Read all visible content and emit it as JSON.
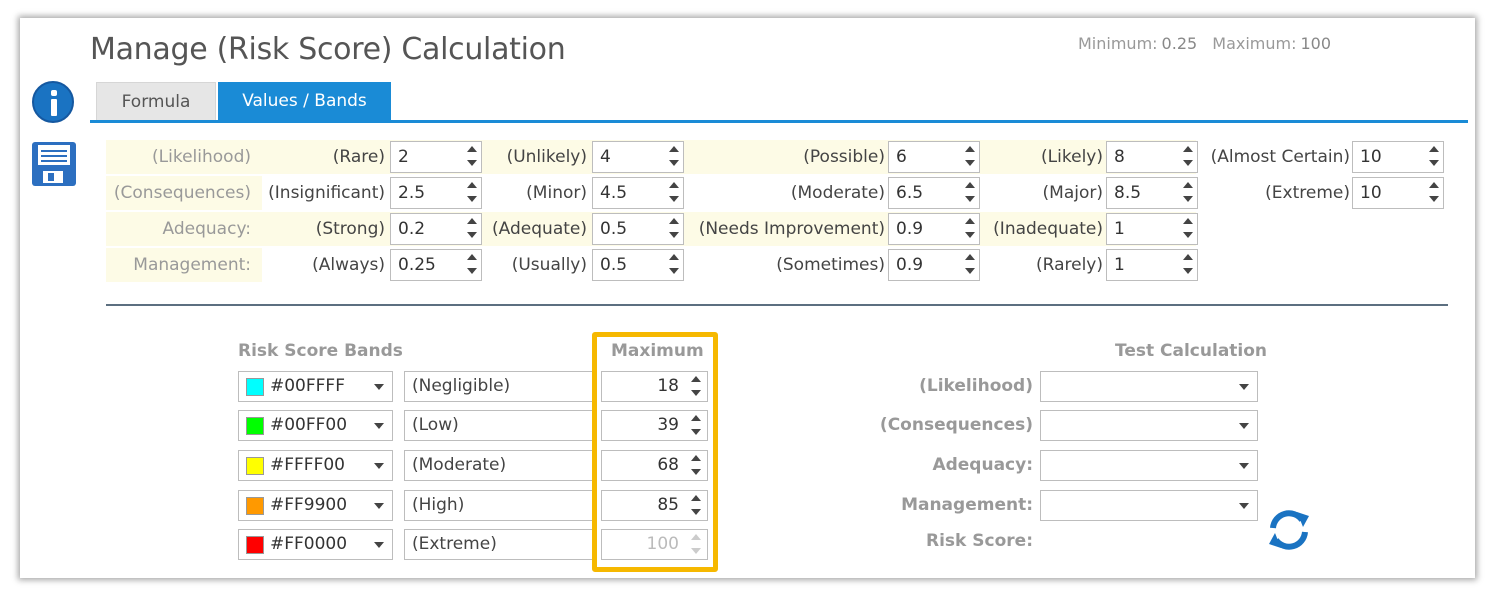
{
  "header": {
    "title": "Manage (Risk Score) Calculation",
    "minimum_label": "Minimum:",
    "minimum_value": "0.25",
    "maximum_label": "Maximum:",
    "maximum_value": "100"
  },
  "tabs": [
    {
      "label": "Formula",
      "active": false
    },
    {
      "label": "Values / Bands",
      "active": true
    }
  ],
  "factors": [
    {
      "label": "(Likelihood)",
      "items": [
        {
          "label": "(Rare)",
          "value": "2"
        },
        {
          "label": "(Unlikely)",
          "value": "4"
        },
        {
          "label": "(Possible)",
          "value": "6"
        },
        {
          "label": "(Likely)",
          "value": "8"
        },
        {
          "label": "(Almost Certain)",
          "value": "10"
        }
      ]
    },
    {
      "label": "(Consequences)",
      "items": [
        {
          "label": "(Insignificant)",
          "value": "2.5"
        },
        {
          "label": "(Minor)",
          "value": "4.5"
        },
        {
          "label": "(Moderate)",
          "value": "6.5"
        },
        {
          "label": "(Major)",
          "value": "8.5"
        },
        {
          "label": "(Extreme)",
          "value": "10"
        }
      ]
    },
    {
      "label": "Adequacy:",
      "items": [
        {
          "label": "(Strong)",
          "value": "0.2"
        },
        {
          "label": "(Adequate)",
          "value": "0.5"
        },
        {
          "label": "(Needs Improvement)",
          "value": "0.9"
        },
        {
          "label": "(Inadequate)",
          "value": "1"
        }
      ]
    },
    {
      "label": "Management:",
      "items": [
        {
          "label": "(Always)",
          "value": "0.25"
        },
        {
          "label": "(Usually)",
          "value": "0.5"
        },
        {
          "label": "(Sometimes)",
          "value": "0.9"
        },
        {
          "label": "(Rarely)",
          "value": "1"
        }
      ]
    }
  ],
  "bands": {
    "title": "Risk Score Bands",
    "max_header": "Maximum",
    "rows": [
      {
        "color": "#00FFFF",
        "name": "(Negligible)",
        "max": "18",
        "disabled": false
      },
      {
        "color": "#00FF00",
        "name": "(Low)",
        "max": "39",
        "disabled": false
      },
      {
        "color": "#FFFF00",
        "name": "(Moderate)",
        "max": "68",
        "disabled": false
      },
      {
        "color": "#FF9900",
        "name": "(High)",
        "max": "85",
        "disabled": false
      },
      {
        "color": "#FF0000",
        "name": "(Extreme)",
        "max": "100",
        "disabled": true
      }
    ]
  },
  "test": {
    "title": "Test Calculation",
    "fields": [
      {
        "label": "(Likelihood)",
        "value": ""
      },
      {
        "label": "(Consequences)",
        "value": ""
      },
      {
        "label": "Adequacy:",
        "value": ""
      },
      {
        "label": "Management:",
        "value": ""
      }
    ],
    "risk_score_label": "Risk Score:"
  },
  "icons": {
    "info": "info-icon",
    "save": "save-icon",
    "refresh": "refresh-icon"
  },
  "colors": {
    "accent": "#1a8bd6",
    "highlight": "#f6b800",
    "row_highlight": "#fdfbe6"
  }
}
